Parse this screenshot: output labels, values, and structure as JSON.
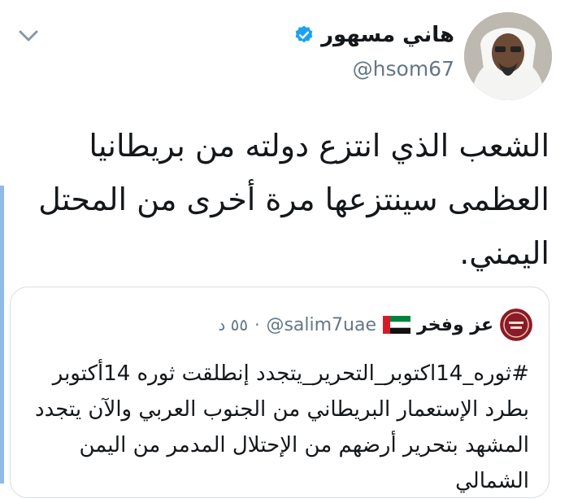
{
  "author": {
    "name": "هاني مسهور",
    "handle": "@hsom67"
  },
  "tweet": {
    "lines": [
      "الشعب الذي انتزع دولته من بريطانيا",
      "العظمى سينتزعها مرة أخرى من المحتل",
      "اليمني."
    ]
  },
  "quoted": {
    "name": "عز وفخر",
    "handle": "@salim7uae",
    "separator": "·",
    "time": "٥٥ د",
    "lines": [
      "#ثوره_14اكتوبر_التحرير_يتجدد إنطلقت ثوره 14أكتوبر",
      "بطرد الإستعمار البريطاني من الجنوب العربي والآن يتجدد",
      "المشهد بتحرير أرضهم من الإحتلال المدمر من اليمن",
      "الشمالي"
    ]
  },
  "icons": {
    "chevron": "chevron-down-icon",
    "verified": "verified-badge-icon",
    "flag": "uae-flag-icon"
  },
  "colors": {
    "text": "#14171a",
    "secondary": "#657786",
    "verified": "#1da1f2",
    "accent_bar": "#8fbbe6",
    "border": "#d6dde3"
  }
}
